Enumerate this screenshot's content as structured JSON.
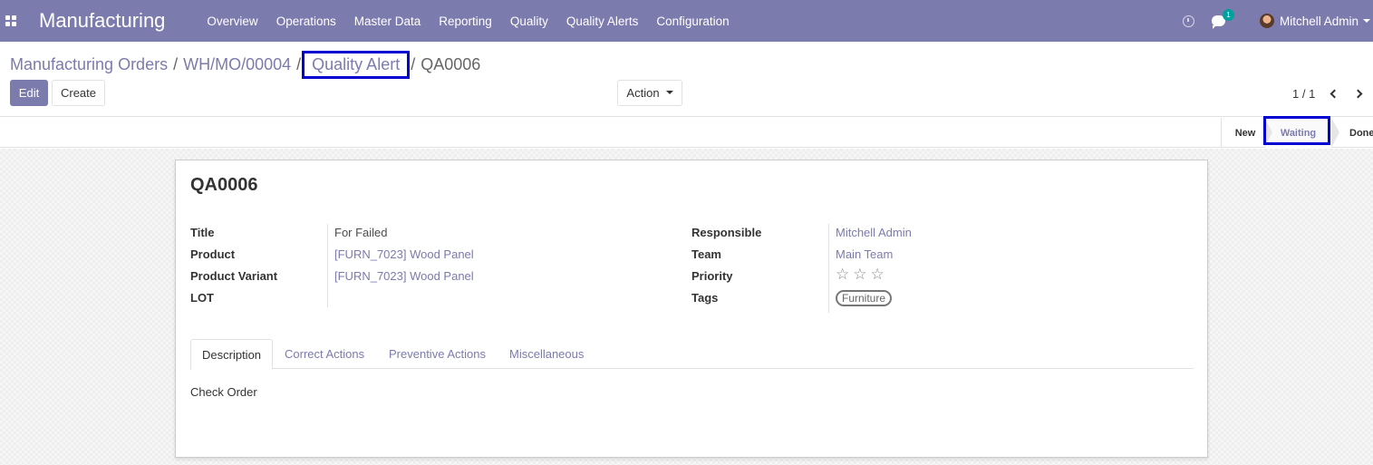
{
  "navbar": {
    "app_name": "Manufacturing",
    "menu": [
      "Overview",
      "Operations",
      "Master Data",
      "Reporting",
      "Quality",
      "Quality Alerts",
      "Configuration"
    ],
    "chat_count": "1",
    "user_name": "Mitchell Admin",
    "bg_color": "#7c7bad"
  },
  "breadcrumb": {
    "items": [
      "Manufacturing Orders",
      "WH/MO/00004",
      "Quality Alert"
    ],
    "separator": "/",
    "current": "QA0006"
  },
  "toolbar": {
    "edit_label": "Edit",
    "create_label": "Create",
    "action_label": "Action"
  },
  "pager": {
    "value": "1 / 1"
  },
  "stages": {
    "new": "New",
    "waiting": "Waiting",
    "done": "Done",
    "current": "Waiting"
  },
  "record": {
    "name": "QA0006",
    "left_fields": [
      {
        "label": "Title",
        "value": "For Failed"
      },
      {
        "label": "Product",
        "value": "[FURN_7023] Wood Panel"
      },
      {
        "label": "Product Variant",
        "value": "[FURN_7023] Wood Panel"
      },
      {
        "label": "LOT",
        "value": ""
      }
    ],
    "right_fields": [
      {
        "label": "Responsible",
        "value": "Mitchell Admin"
      },
      {
        "label": "Team",
        "value": "Main Team"
      },
      {
        "label": "Priority",
        "value": "0 of 3 stars"
      },
      {
        "label": "Tags",
        "value": "Furniture"
      }
    ],
    "priority_stars": 0,
    "priority_max": 3
  },
  "tabs": {
    "items": [
      "Description",
      "Correct Actions",
      "Preventive Actions",
      "Miscellaneous"
    ],
    "active": "Description",
    "content": "Check Order"
  }
}
